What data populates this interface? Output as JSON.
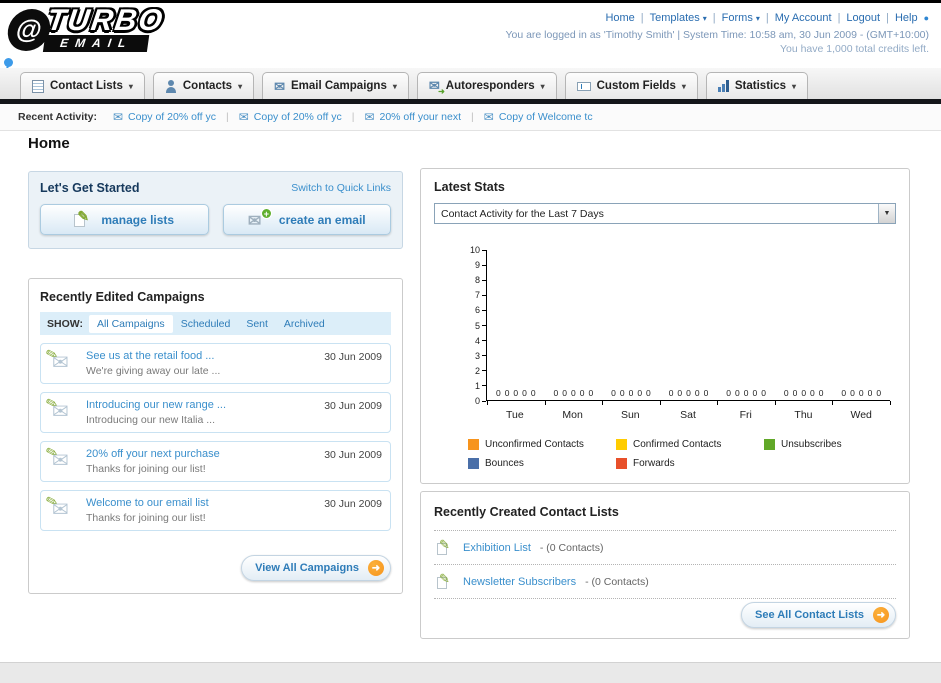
{
  "icons": {
    "envelope": "✉",
    "pencil": "✎",
    "dropdown_arrow": "▾",
    "select_arrow": "▼",
    "arrow_right": "➜",
    "plus": "+",
    "bullet": "●",
    "swirl": "@"
  },
  "header": {
    "logo_line1": "TURBO",
    "logo_line2": "EMAIL",
    "nav": [
      {
        "label": "Home"
      },
      {
        "label": "Templates"
      },
      {
        "label": "Forms"
      },
      {
        "label": "My Account"
      },
      {
        "label": "Logout"
      },
      {
        "label": "Help"
      }
    ],
    "login_text": "You are logged in as 'Timothy Smith' | System Time: 10:58 am, 30 Jun 2009 - (GMT+10:00)",
    "credits_text": "You have 1,000 total credits left."
  },
  "tabs": [
    {
      "label": "Contact Lists",
      "icon": "contact-lists-icon"
    },
    {
      "label": "Contacts",
      "icon": "contacts-icon"
    },
    {
      "label": "Email Campaigns",
      "icon": "email-campaigns-icon"
    },
    {
      "label": "Autoresponders",
      "icon": "autoresponders-icon"
    },
    {
      "label": "Custom Fields",
      "icon": "custom-fields-icon"
    },
    {
      "label": "Statistics",
      "icon": "statistics-icon"
    }
  ],
  "recent_activity": {
    "label": "Recent Activity:",
    "items": [
      "Copy of 20% off yc",
      "Copy of 20% off yc",
      "20% off your next",
      "Copy of Welcome tc"
    ]
  },
  "page_title": "Home",
  "get_started": {
    "title": "Let's Get Started",
    "switch_link": "Switch to Quick Links",
    "manage_button": "manage lists",
    "create_button": "create an email"
  },
  "campaigns": {
    "title": "Recently Edited Campaigns",
    "show_label": "SHOW:",
    "filters": [
      "All Campaigns",
      "Scheduled",
      "Sent",
      "Archived"
    ],
    "items": [
      {
        "title": "See us at the retail food ...",
        "subtitle": "We're giving away our late ...",
        "date": "30 Jun 2009"
      },
      {
        "title": "Introducing our new range ...",
        "subtitle": "Introducing our new Italia ...",
        "date": "30 Jun 2009"
      },
      {
        "title": "20% off your next purchase",
        "subtitle": "Thanks for joining our list!",
        "date": "30 Jun 2009"
      },
      {
        "title": "Welcome to our email list",
        "subtitle": "Thanks for joining our list!",
        "date": "30 Jun 2009"
      }
    ],
    "view_all_label": "View All Campaigns"
  },
  "stats": {
    "title": "Latest Stats",
    "dropdown_value": "Contact Activity for the Last 7 Days",
    "chart_data": {
      "type": "bar",
      "title": "Contact Activity for the Last 7 Days",
      "categories": [
        "Tue",
        "Mon",
        "Sun",
        "Sat",
        "Fri",
        "Thu",
        "Wed"
      ],
      "series": [
        {
          "name": "Unconfirmed Contacts",
          "color": "#F7941D",
          "values": [
            0,
            0,
            0,
            0,
            0,
            0,
            0
          ]
        },
        {
          "name": "Confirmed Contacts",
          "color": "#FFCC00",
          "values": [
            0,
            0,
            0,
            0,
            0,
            0,
            0
          ]
        },
        {
          "name": "Unsubscribes",
          "color": "#61A828",
          "values": [
            0,
            0,
            0,
            0,
            0,
            0,
            0
          ]
        },
        {
          "name": "Bounces",
          "color": "#4A6FA8",
          "values": [
            0,
            0,
            0,
            0,
            0,
            0,
            0
          ]
        },
        {
          "name": "Forwards",
          "color": "#E8502A",
          "values": [
            0,
            0,
            0,
            0,
            0,
            0,
            0
          ]
        }
      ],
      "ylim": [
        0,
        10
      ],
      "y_tick_step": 1,
      "value_labels_shown": true,
      "grid": false,
      "legend_position": "bottom"
    }
  },
  "contact_lists": {
    "title": "Recently Created Contact Lists",
    "items": [
      {
        "name": "Exhibition List",
        "detail": "- (0 Contacts)"
      },
      {
        "name": "Newsletter Subscribers",
        "detail": "- (0 Contacts)"
      }
    ],
    "see_all_label": "See All Contact Lists"
  }
}
